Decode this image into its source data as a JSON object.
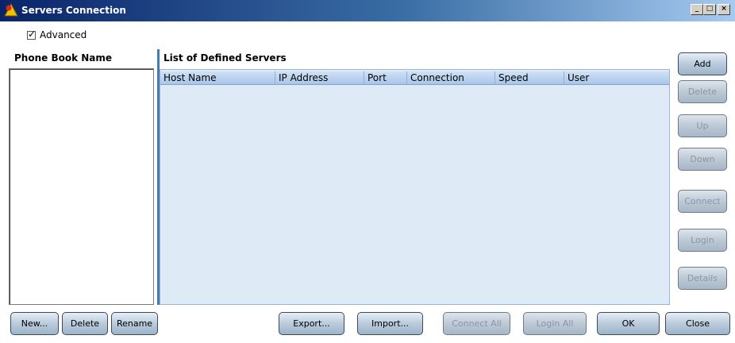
{
  "window": {
    "title": "Servers Connection",
    "controls": {
      "minimize": "_",
      "maximize": "□",
      "close": "×"
    }
  },
  "advanced": {
    "label": "Advanced",
    "checked": true
  },
  "phonebook": {
    "label": "Phone Book Name"
  },
  "servers": {
    "label": "List of Defined Servers",
    "columns": [
      "Host Name",
      "IP Address",
      "Port",
      "Connection",
      "Speed",
      "User"
    ]
  },
  "side_buttons": {
    "add": "Add",
    "delete": "Delete",
    "up": "Up",
    "down": "Down",
    "connect": "Connect",
    "login": "Login",
    "details": "Details"
  },
  "bottom_buttons": {
    "new": "New...",
    "delete": "Delete",
    "rename": "Rename",
    "export": "Export...",
    "import": "Import...",
    "connect_all": "Connect All",
    "login_all": "Login All",
    "ok": "OK",
    "close": "Close"
  },
  "colors": {
    "title_start": "#0a246a",
    "title_end": "#a6caf0",
    "grid_bg": "#dfeaf7",
    "grid_header": "#a9c6e9"
  }
}
